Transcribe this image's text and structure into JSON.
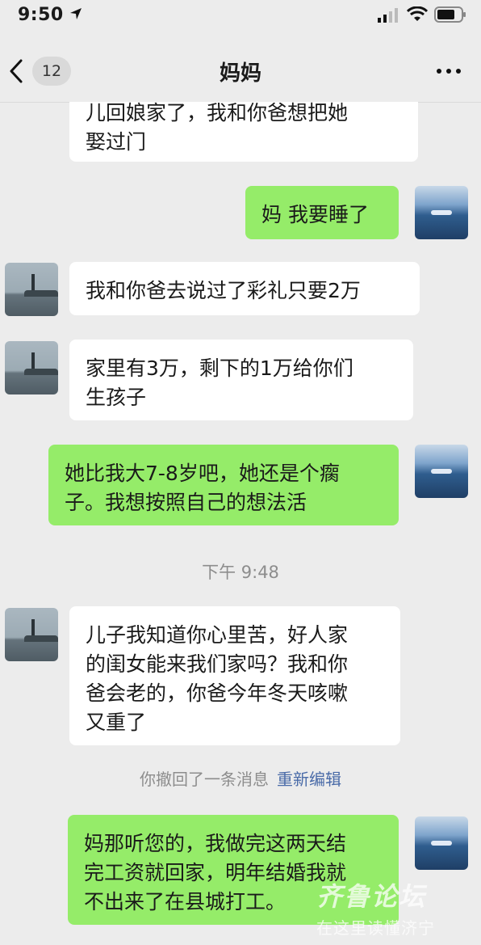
{
  "status_bar": {
    "time": "9:50"
  },
  "nav": {
    "unread_count": "12",
    "title": "妈妈"
  },
  "messages": {
    "m1": {
      "lines": [
        "儿回娘家了，我和你爸想把她",
        "娶过门"
      ]
    },
    "m2": {
      "lines": [
        "妈 我要睡了"
      ]
    },
    "m3": {
      "lines": [
        "我和你爸去说过了彩礼只要2万"
      ]
    },
    "m4": {
      "lines": [
        "家里有3万，剩下的1万给你们",
        "生孩子"
      ]
    },
    "m5": {
      "lines": [
        "她比我大7-8岁吧，她还是个瘸",
        "子。我想按照自己的想法活"
      ]
    },
    "m6": {
      "lines": [
        "儿子我知道你心里苦，好人家",
        "的闺女能来我们家吗？我和你",
        "爸会老的，你爸今年冬天咳嗽",
        "又重了"
      ]
    },
    "m7": {
      "lines": [
        "妈那听您的，我做完这两天结",
        "完工资就回家，明年结婚我就",
        "不出来了在县城打工。"
      ]
    }
  },
  "timestamp": "下午 9:48",
  "system_message": {
    "text": "你撤回了一条消息",
    "link": "重新编辑"
  },
  "watermark": {
    "top": "齐鲁论坛",
    "bottom": "在这里读懂济宁"
  },
  "colors": {
    "incoming_bubble": "#ffffff",
    "outgoing_bubble": "#95ec69",
    "background": "#ececec",
    "link": "#4a6ba8"
  }
}
